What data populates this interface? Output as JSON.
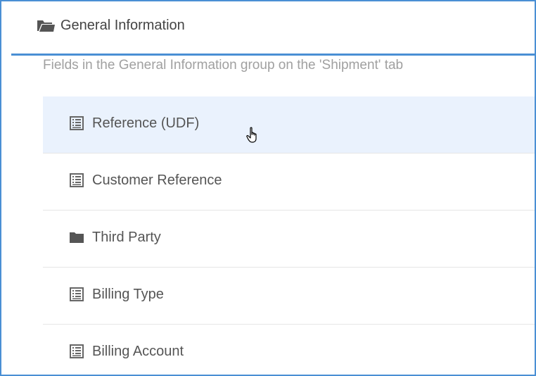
{
  "group": {
    "title": "General Information",
    "icon": "folder-open-icon",
    "description": "Fields in the General Information group on the 'Shipment' tab"
  },
  "items": [
    {
      "label": "Reference (UDF)",
      "icon": "list-icon",
      "hovered": true
    },
    {
      "label": "Customer Reference",
      "icon": "list-icon",
      "hovered": false
    },
    {
      "label": "Third Party",
      "icon": "folder-icon",
      "hovered": false
    },
    {
      "label": "Billing Type",
      "icon": "list-icon",
      "hovered": false
    },
    {
      "label": "Billing Account",
      "icon": "list-icon",
      "hovered": false
    }
  ],
  "colors": {
    "accent": "#4a8fd4",
    "hover_row": "#eaf2fd",
    "icon": "#666666"
  }
}
